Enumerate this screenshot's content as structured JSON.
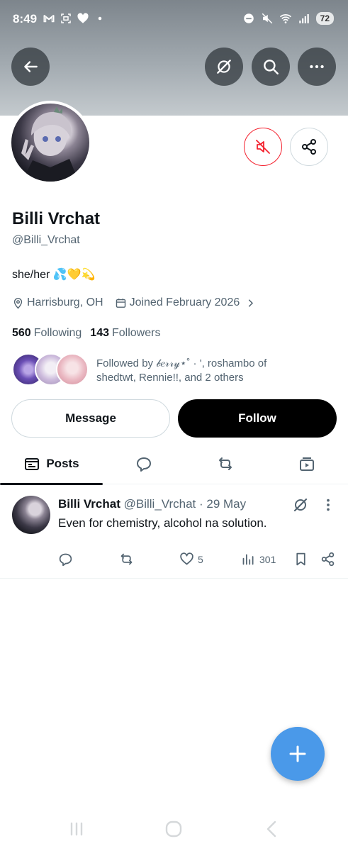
{
  "status_bar": {
    "time": "8:49",
    "battery": "72",
    "left_icons": [
      "gmail-icon",
      "screenshot-icon",
      "heart-icon",
      "dot-icon"
    ],
    "right_icons": [
      "dnd-icon",
      "mute-icon",
      "wifi-icon",
      "signal-icon"
    ]
  },
  "header": {
    "back_icon": "arrow-left-icon",
    "grok_icon": "grok-icon",
    "search_icon": "search-icon",
    "more_icon": "more-horizontal-icon"
  },
  "profile": {
    "name": "Billi Vrchat",
    "handle": "@Billi_Vrchat",
    "bio": "she/her 💦💛💫",
    "location": "Harrisburg, OH",
    "joined": "Joined February 2026",
    "following_count": "560",
    "following_label": "Following",
    "followers_count": "143",
    "followers_label": "Followers",
    "followed_by": "Followed by 𝒷𝑒𝓇𝓇𝓎⋆˚ · ', roshambo of shedtwt, Rennie!!, and 2 others"
  },
  "buttons": {
    "message": "Message",
    "follow": "Follow"
  },
  "tabs": [
    {
      "label": "Posts",
      "icon": "posts-icon"
    },
    {
      "label": "",
      "icon": "replies-icon"
    },
    {
      "label": "",
      "icon": "repost-icon"
    },
    {
      "label": "",
      "icon": "media-icon"
    }
  ],
  "post": {
    "author_name": "Billi Vrchat",
    "author_handle": "@Billi_Vrchat · 29 May",
    "text": "Even for chemistry, alcohol na solution.",
    "likes": "5",
    "views": "301"
  },
  "colors": {
    "accent": "#4a99e9",
    "mute_red": "#f4212e",
    "text": "#0f1419",
    "secondary": "#536471"
  }
}
